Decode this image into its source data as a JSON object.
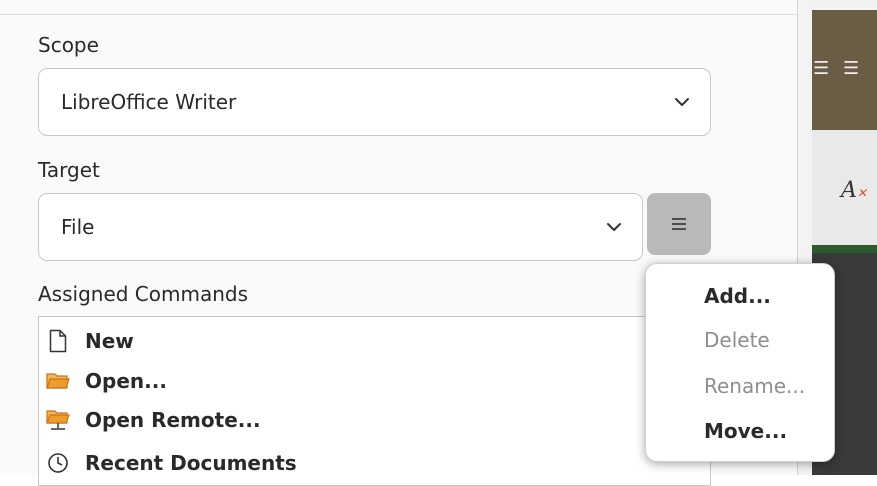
{
  "scope": {
    "label": "Scope",
    "value": "LibreOffice Writer"
  },
  "target": {
    "label": "Target",
    "value": "File"
  },
  "assigned": {
    "label": "Assigned Commands",
    "items": [
      {
        "icon": "document-icon",
        "label": "New"
      },
      {
        "icon": "folder-icon",
        "label": "Open..."
      },
      {
        "icon": "remote-folder-icon",
        "label": "Open Remote..."
      },
      {
        "icon": "clock-icon",
        "label": "Recent Documents"
      }
    ]
  },
  "menu_button": {
    "icon": "hamburger-menu-icon"
  },
  "popup_menu": {
    "items": [
      {
        "label": "Add...",
        "enabled": true
      },
      {
        "label": "Delete",
        "enabled": false
      },
      {
        "label": "Rename...",
        "enabled": false
      },
      {
        "label": "Move...",
        "enabled": true
      }
    ]
  },
  "colors": {
    "folder": "#f09a2a",
    "menu_button_bg": "#b9b9b9",
    "disabled_text": "#8e8e8e"
  }
}
